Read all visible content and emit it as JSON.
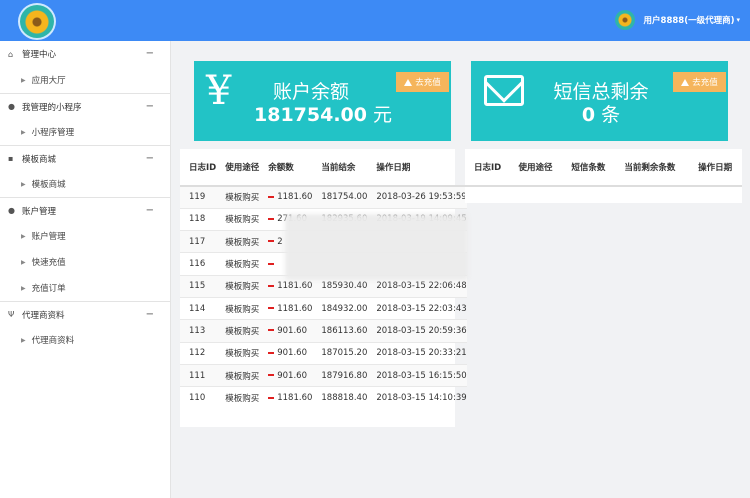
{
  "header": {
    "logo": "flower-logo",
    "user_label": "用户8888(一级代理商)",
    "caret": "▾"
  },
  "sidebar": {
    "groups": [
      {
        "icon": "home-icon",
        "glyph": "⌂",
        "label": "管理中心",
        "toggle": "−",
        "items": [
          "应用大厅"
        ]
      },
      {
        "icon": "chat-icon",
        "glyph": "●",
        "label": "我管理的小程序",
        "toggle": "−",
        "items": [
          "小程序管理"
        ]
      },
      {
        "icon": "store-icon",
        "glyph": "▪",
        "label": "模板商城",
        "toggle": "−",
        "items": [
          "模板商城"
        ]
      },
      {
        "icon": "user-icon",
        "glyph": "●",
        "label": "账户管理",
        "toggle": "−",
        "items": [
          "账户管理",
          "快速充值",
          "充值订单"
        ]
      },
      {
        "icon": "agent-icon",
        "glyph": "Ψ",
        "label": "代理商资料",
        "toggle": "−",
        "items": [
          "代理商资料"
        ]
      }
    ]
  },
  "cards": {
    "balance": {
      "icon": "yen-icon",
      "glyph": "¥",
      "title": "账户余额",
      "value": "181754.00",
      "unit": "元",
      "button": "去充值"
    },
    "sms": {
      "icon": "mail-icon",
      "title": "短信总剩余",
      "value": "0",
      "unit": "条",
      "button": "去充值"
    }
  },
  "log_table": {
    "columns": [
      "日志ID",
      "使用途径",
      "余额数",
      "当前结余",
      "操作日期"
    ],
    "rows": [
      [
        "119",
        "模板购买",
        "1181.60",
        "181754.00",
        "2018-03-26 19:53:59"
      ],
      [
        "118",
        "模板购买",
        "271.60",
        "182935.60",
        "2018-03-19 14:09:45"
      ],
      [
        "117",
        "模板购买",
        "2",
        "",
        ""
      ],
      [
        "116",
        "模板购买",
        "",
        "",
        ""
      ],
      [
        "115",
        "模板购买",
        "1181.60",
        "185930.40",
        "2018-03-15 22:06:48"
      ],
      [
        "114",
        "模板购买",
        "1181.60",
        "184932.00",
        "2018-03-15 22:03:43"
      ],
      [
        "113",
        "模板购买",
        "901.60",
        "186113.60",
        "2018-03-15 20:59:36"
      ],
      [
        "112",
        "模板购买",
        "901.60",
        "187015.20",
        "2018-03-15 20:33:21"
      ],
      [
        "111",
        "模板购买",
        "901.60",
        "187916.80",
        "2018-03-15 16:15:50"
      ],
      [
        "110",
        "模板购买",
        "1181.60",
        "188818.40",
        "2018-03-15 14:10:39"
      ]
    ]
  },
  "sms_table": {
    "columns": [
      "日志ID",
      "使用途径",
      "短信条数",
      "当前剩余条数",
      "操作日期"
    ]
  }
}
